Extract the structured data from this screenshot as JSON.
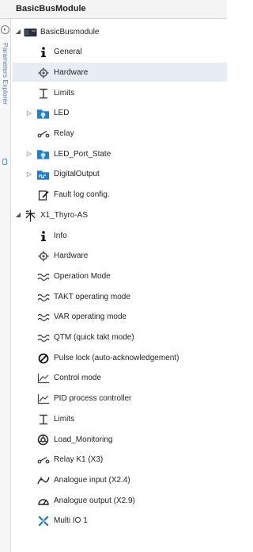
{
  "window": {
    "title": "BasicBusModule"
  },
  "side_panel": {
    "label": "Parameters Explorer"
  },
  "tree": [
    {
      "label": "BasicBusmodule",
      "icon": "module-board-icon",
      "level": 0,
      "expander": "expanded"
    },
    {
      "label": "General",
      "icon": "info-icon",
      "level": 1,
      "expander": "none"
    },
    {
      "label": "Hardware",
      "icon": "gear-icon",
      "level": 1,
      "expander": "none",
      "selected": true
    },
    {
      "label": "Limits",
      "icon": "limits-icon",
      "level": 1,
      "expander": "none"
    },
    {
      "label": "LED",
      "icon": "led-folder-icon",
      "level": 1,
      "expander": "collapsed"
    },
    {
      "label": "Relay",
      "icon": "relay-icon",
      "level": 1,
      "expander": "none"
    },
    {
      "label": "LED_Port_State",
      "icon": "led-folder-icon",
      "level": 1,
      "expander": "collapsed"
    },
    {
      "label": "DigitalOutput",
      "icon": "digital-output-folder-icon",
      "level": 1,
      "expander": "collapsed"
    },
    {
      "label": "Fault log config.",
      "icon": "edit-document-icon",
      "level": 1,
      "expander": "none"
    },
    {
      "label": "X1_Thyro-AS",
      "icon": "thyristor-icon",
      "level": 0,
      "expander": "expanded"
    },
    {
      "label": "Info",
      "icon": "info-icon",
      "level": 1,
      "expander": "none"
    },
    {
      "label": "Hardware",
      "icon": "gear-icon",
      "level": 1,
      "expander": "none"
    },
    {
      "label": "Operation Mode",
      "icon": "waveform-icon",
      "level": 1,
      "expander": "none"
    },
    {
      "label": "TAKT operating mode",
      "icon": "waveform-icon",
      "level": 1,
      "expander": "none"
    },
    {
      "label": "VAR operating mode",
      "icon": "waveform-icon",
      "level": 1,
      "expander": "none"
    },
    {
      "label": "QTM (quick takt mode)",
      "icon": "waveform-icon",
      "level": 1,
      "expander": "none"
    },
    {
      "label": "Pulse lock (auto-acknowledgement)",
      "icon": "prohibited-icon",
      "level": 1,
      "expander": "none"
    },
    {
      "label": "Control mode",
      "icon": "line-chart-icon",
      "level": 1,
      "expander": "none"
    },
    {
      "label": "PID process controller",
      "icon": "line-chart-icon",
      "level": 1,
      "expander": "none"
    },
    {
      "label": "Limits",
      "icon": "limits-icon",
      "level": 1,
      "expander": "none"
    },
    {
      "label": "Load_Monitoring",
      "icon": "load-monitor-icon",
      "level": 1,
      "expander": "none"
    },
    {
      "label": "Relay K1 (X3)",
      "icon": "relay-icon",
      "level": 1,
      "expander": "none"
    },
    {
      "label": "Analogue input (X2.4)",
      "icon": "analogue-input-icon",
      "level": 1,
      "expander": "none"
    },
    {
      "label": "Analogue output (X2.9)",
      "icon": "gauge-icon",
      "level": 1,
      "expander": "none"
    },
    {
      "label": "Multi IO 1",
      "icon": "multi-io-icon",
      "level": 1,
      "expander": "none"
    }
  ]
}
